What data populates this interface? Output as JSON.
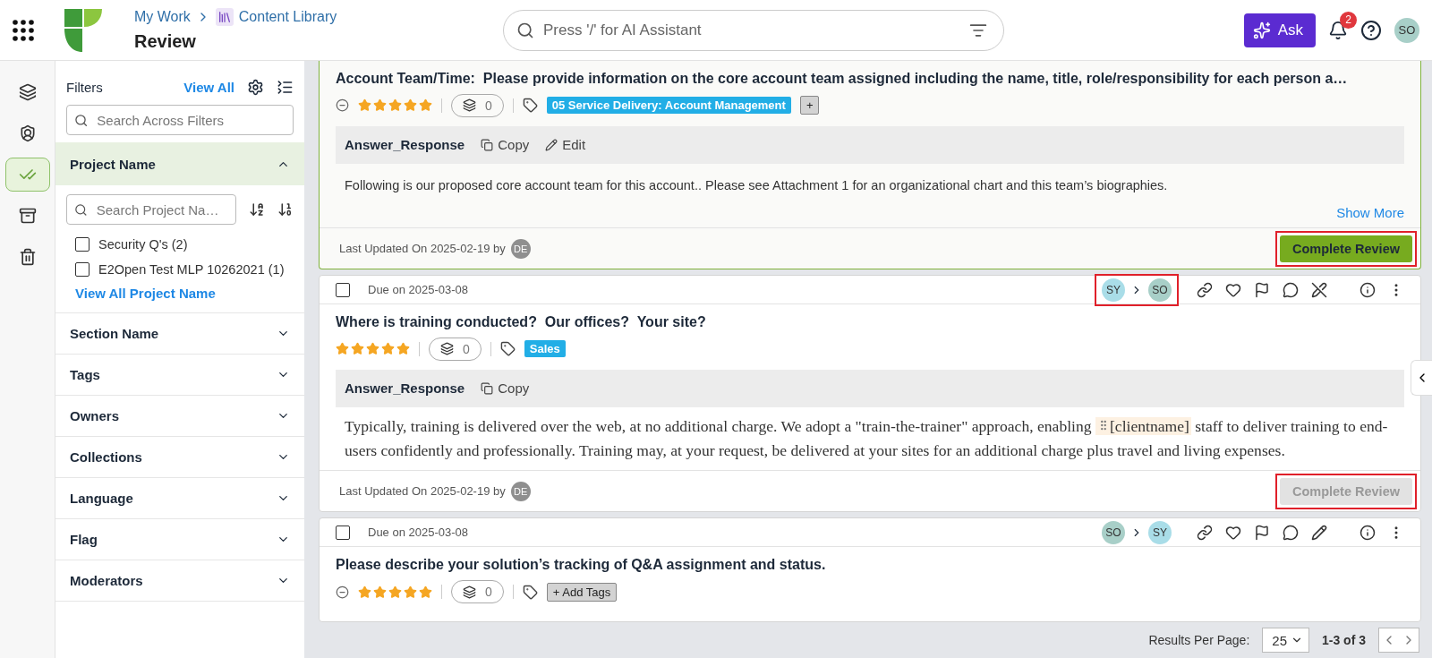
{
  "header": {
    "breadcrumb": [
      "My Work",
      "Content Library"
    ],
    "title": "Review",
    "search_placeholder": "Press '/' for AI Assistant",
    "ask_label": "Ask",
    "notification_count": "2",
    "user_initials": "SO"
  },
  "rail": [
    {
      "selected": false
    },
    {
      "selected": false
    },
    {
      "selected": true
    },
    {
      "selected": false
    },
    {
      "selected": false
    }
  ],
  "filters": {
    "title": "Filters",
    "view_all": "View All",
    "search_placeholder": "Search Across Filters",
    "sections": [
      {
        "label": "Project Name",
        "expanded": true,
        "search_placeholder": "Search Project Na…",
        "options": [
          {
            "label": "Security Q's",
            "count": "(2)",
            "checked": false
          },
          {
            "label": "E2Open Test MLP 10262021",
            "count": "(1)",
            "checked": false
          }
        ],
        "view_all_link": "View All Project Name"
      },
      {
        "label": "Section Name",
        "expanded": false
      },
      {
        "label": "Tags",
        "expanded": false
      },
      {
        "label": "Owners",
        "expanded": false
      },
      {
        "label": "Collections",
        "expanded": false
      },
      {
        "label": "Language",
        "expanded": false
      },
      {
        "label": "Flag",
        "expanded": false
      },
      {
        "label": "Moderators",
        "expanded": false
      }
    ]
  },
  "cards": [
    {
      "selected": true,
      "title": "Account Team/Time:  Please provide information on the core account team assigned including the name, title, role/responsibility for each person a…",
      "unrated_icon": true,
      "stars": 5,
      "collections": "0",
      "tags": [
        {
          "kind": "tag",
          "label": "05 Service Delivery: Account Management"
        },
        {
          "kind": "add",
          "label": "+"
        }
      ],
      "answer_label": "Answer_Response",
      "answer_actions": [
        {
          "kind": "copy",
          "label": "Copy"
        },
        {
          "kind": "edit",
          "label": "Edit"
        }
      ],
      "kind": "plain",
      "answer": [
        {
          "kind": "text",
          "text": "Following is our proposed core account team for this account.. Please see Attachment 1 for an organizational chart and this team’s biographies."
        }
      ],
      "show_more": "Show More",
      "updated": "Last Updated On 2025-02-19 by",
      "updater": "DE",
      "review": {
        "label": "Complete Review",
        "disabled": false,
        "highlighted": true
      }
    },
    {
      "selected": false,
      "checked": false,
      "due": "Due on 2025-03-08",
      "assignees": [
        {
          "initials": "SY",
          "color": "#a9dde8"
        },
        {
          "initials": "SO",
          "color": "#a8cfc8"
        }
      ],
      "assignees_highlighted": true,
      "edit_locked": true,
      "title": "Where is training conducted?  Our offices?  Your site?",
      "unrated_icon": false,
      "stars": 5,
      "collections": "0",
      "tags": [
        {
          "kind": "tag",
          "label": "Sales"
        }
      ],
      "answer_label": "Answer_Response",
      "answer_actions": [
        {
          "kind": "copy",
          "label": "Copy"
        }
      ],
      "kind": "formatted",
      "answer": [
        {
          "kind": "text",
          "text": "Typically, training is delivered over the web, at no additional charge. We adopt a \"train-the-trainer\" approach, enabling "
        },
        {
          "kind": "token",
          "text": "[clientname]"
        },
        {
          "kind": "text",
          "text": " staff to deliver training to end-users confidently and professionally. Training may, at your request, be delivered at your sites for an additional charge plus travel and living expenses."
        }
      ],
      "updated": "Last Updated On 2025-02-19 by",
      "updater": "DE",
      "review": {
        "label": "Complete Review",
        "disabled": true,
        "highlighted": true
      }
    },
    {
      "selected": false,
      "checked": false,
      "due": "Due on 2025-03-08",
      "assignees": [
        {
          "initials": "SO",
          "color": "#a8cfc8"
        },
        {
          "initials": "SY",
          "color": "#a9dde8"
        }
      ],
      "assignees_highlighted": false,
      "edit_locked": false,
      "title": "Please describe your solution’s tracking of Q&A assignment and status.",
      "unrated_icon": true,
      "stars": 5,
      "collections": "0",
      "tags": [
        {
          "kind": "add",
          "label": "+ Add Tags"
        }
      ]
    }
  ],
  "pagination": {
    "label": "Results Per Page:",
    "per_page": "25",
    "range": "1-3 of 3"
  }
}
